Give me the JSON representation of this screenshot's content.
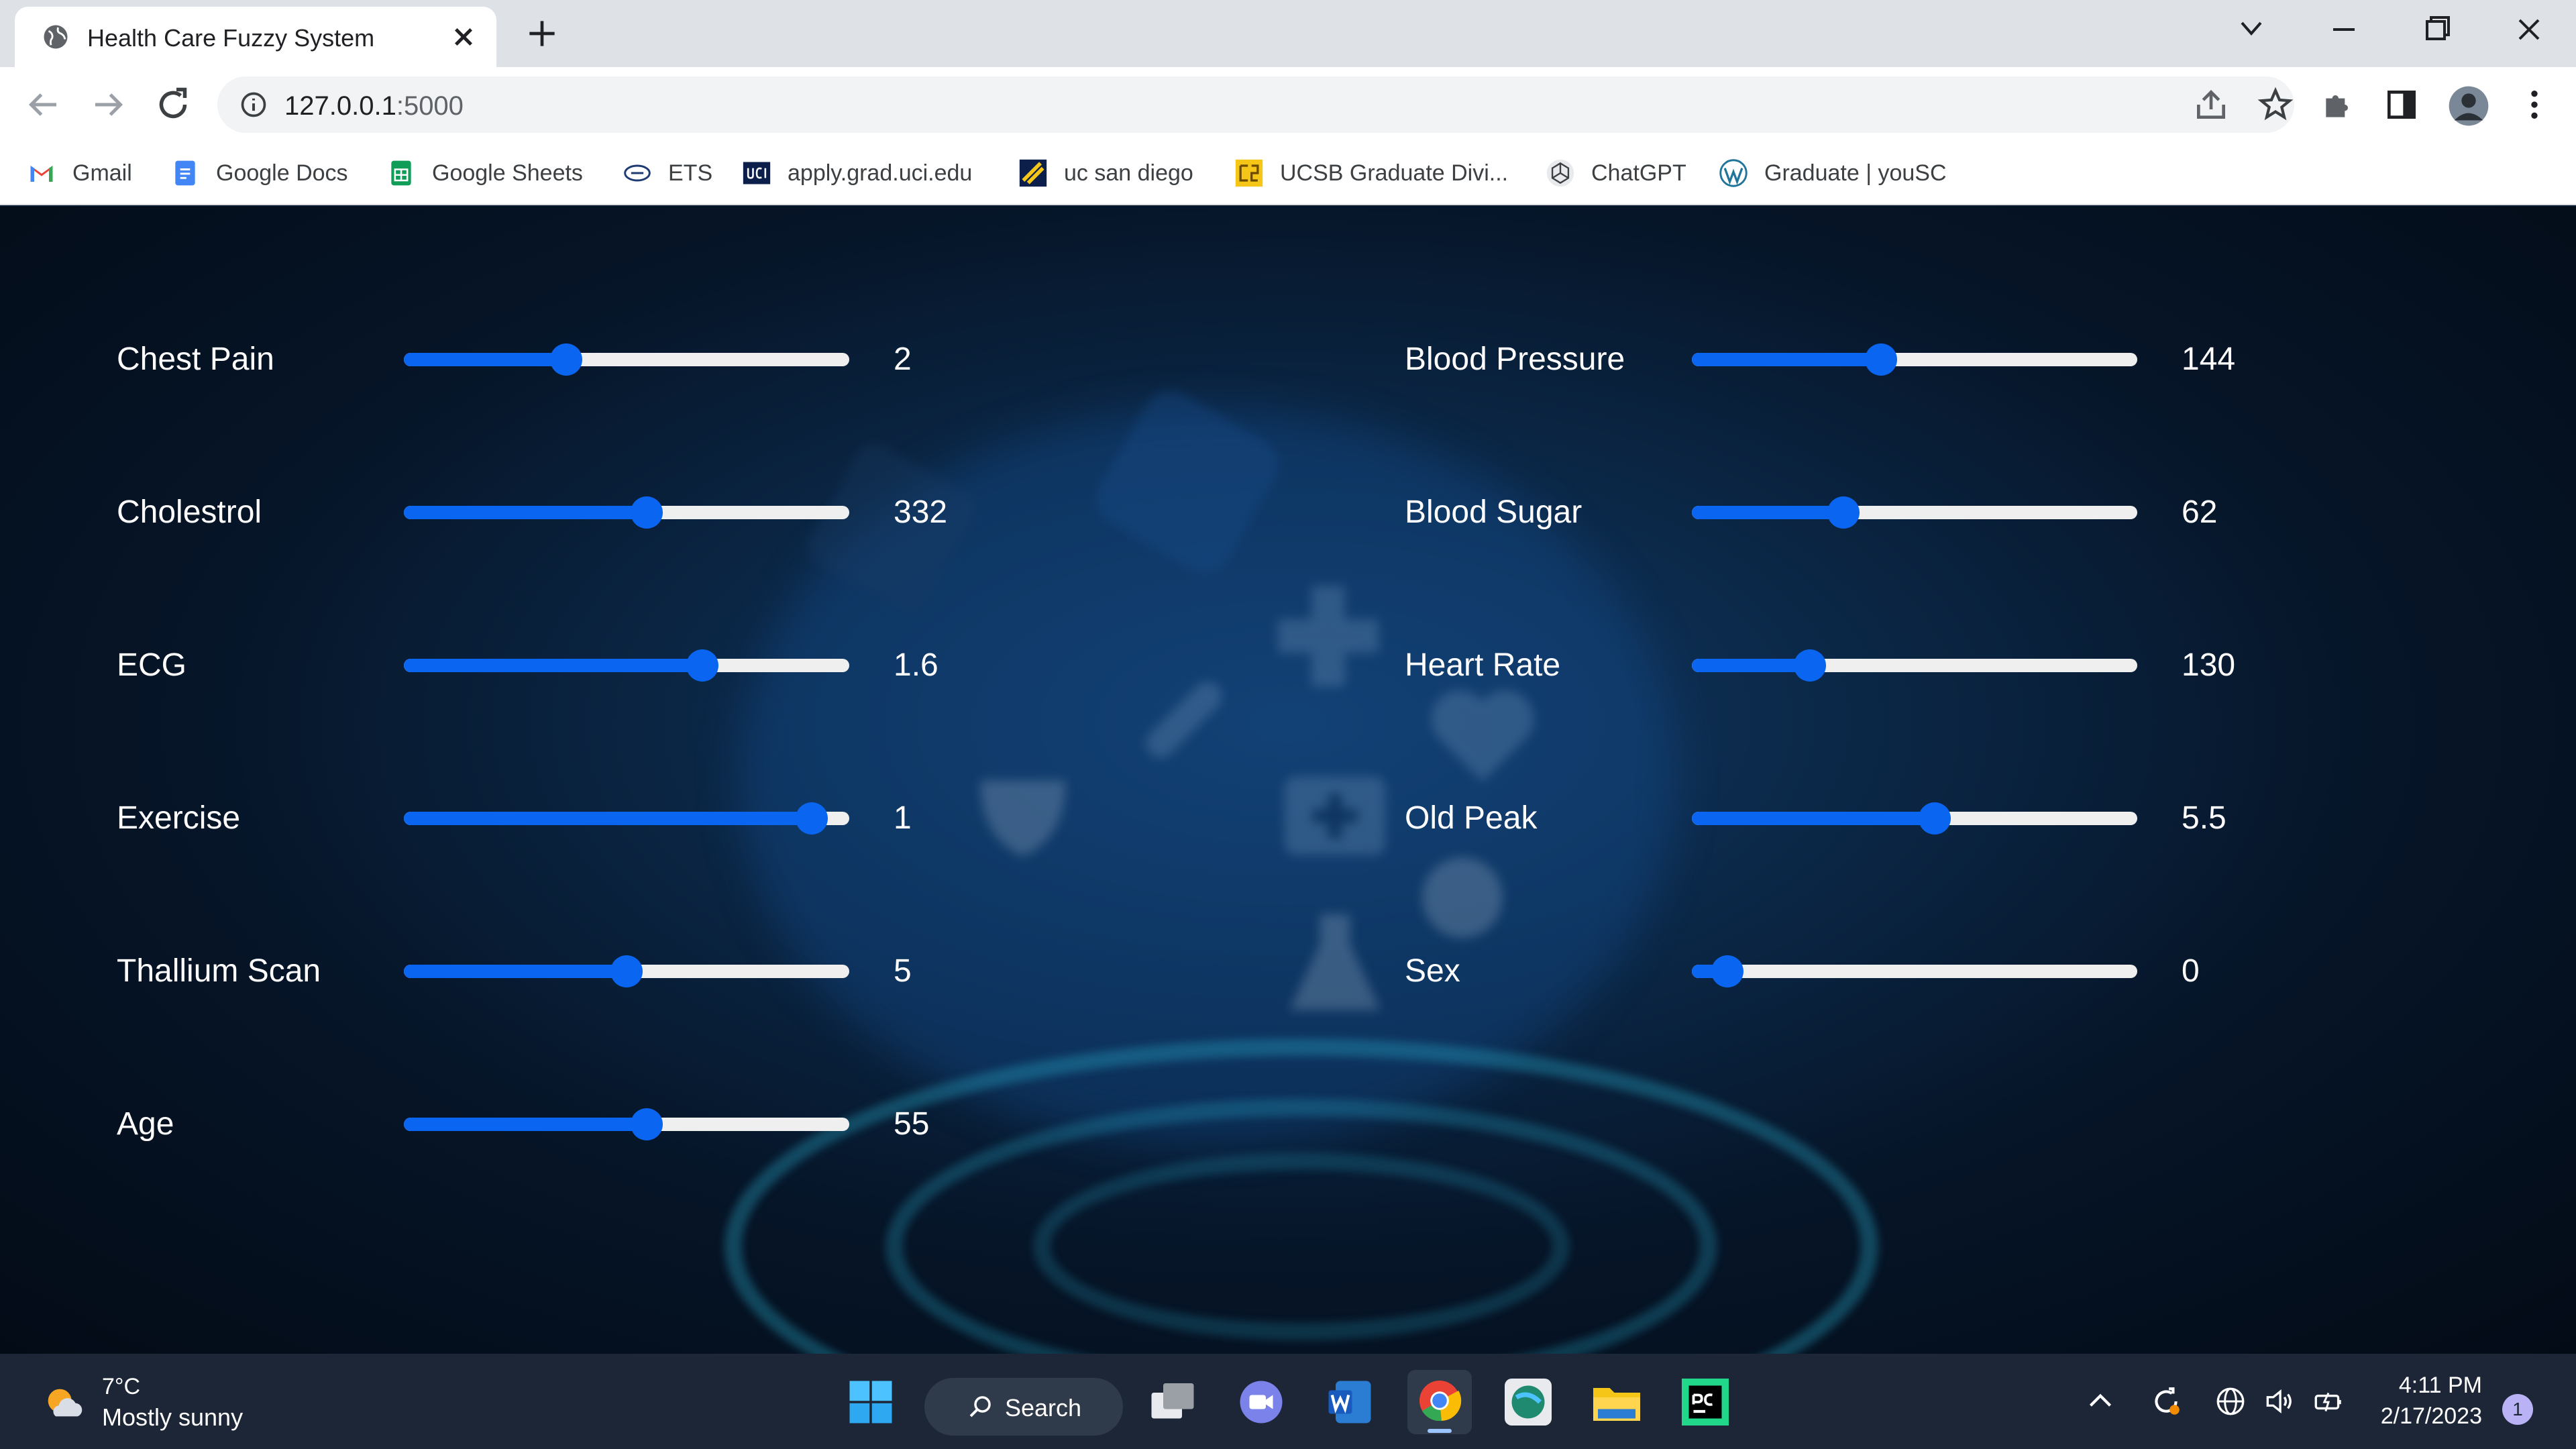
{
  "browser": {
    "tab_title": "Health Care Fuzzy System",
    "url_host": "127.0.0.1",
    "url_port": ":5000"
  },
  "bookmarks": [
    {
      "label": "Gmail",
      "icon": "gmail-icon"
    },
    {
      "label": "Google Docs",
      "icon": "google-docs-icon"
    },
    {
      "label": "Google Sheets",
      "icon": "google-sheets-icon"
    },
    {
      "label": "ETS",
      "icon": "ets-icon"
    },
    {
      "label": "apply.grad.uci.edu",
      "icon": "uci-icon"
    },
    {
      "label": "uc san diego",
      "icon": "ucsd-icon"
    },
    {
      "label": "UCSB Graduate Divi...",
      "icon": "ucsb-icon"
    },
    {
      "label": "ChatGPT",
      "icon": "chatgpt-icon"
    },
    {
      "label": "Graduate | youSC",
      "icon": "wordpress-icon"
    }
  ],
  "parameters": {
    "left": [
      {
        "label": "Chest Pain",
        "value": "2",
        "fill": 0.365
      },
      {
        "label": "Cholestrol",
        "value": "332",
        "fill": 0.545
      },
      {
        "label": "ECG",
        "value": "1.6",
        "fill": 0.67
      },
      {
        "label": "Exercise",
        "value": "1",
        "fill": 0.915
      },
      {
        "label": "Thallium Scan",
        "value": "5",
        "fill": 0.5
      },
      {
        "label": "Age",
        "value": "55",
        "fill": 0.545
      }
    ],
    "right": [
      {
        "label": "Blood Pressure",
        "value": "144",
        "fill": 0.425
      },
      {
        "label": "Blood Sugar",
        "value": "62",
        "fill": 0.34
      },
      {
        "label": "Heart Rate",
        "value": "130",
        "fill": 0.265
      },
      {
        "label": "Old Peak",
        "value": "5.5",
        "fill": 0.545
      },
      {
        "label": "Sex",
        "value": "0",
        "fill": 0.08
      }
    ]
  },
  "taskbar": {
    "weather_temp": "7°C",
    "weather_desc": "Mostly sunny",
    "search_label": "Search",
    "time": "4:11 PM",
    "date": "2/17/2023",
    "notifications": "1"
  },
  "colors": {
    "slider_accent": "#0a66f0",
    "slider_track": "#efefef",
    "page_background": "#0a1a2e"
  }
}
